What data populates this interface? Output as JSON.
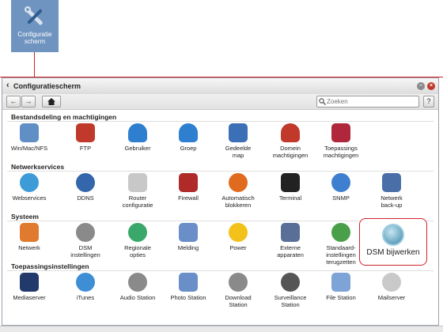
{
  "desktop_icon": {
    "label_line1": "Configuratie",
    "label_line2": "scherm"
  },
  "window": {
    "title": "Configuratiescherm"
  },
  "toolbar": {
    "search_placeholder": "Zoeken",
    "help_label": "?"
  },
  "sections": [
    {
      "title": "Bestandsdeling en machtigingen",
      "items": [
        {
          "l1": "Win/Mac/NFS",
          "l2": "",
          "color": "#5f8fc4"
        },
        {
          "l1": "FTP",
          "l2": "",
          "color": "#c0392b"
        },
        {
          "l1": "Gebruiker",
          "l2": "",
          "color": "#2f7fd1"
        },
        {
          "l1": "Groep",
          "l2": "",
          "color": "#2f7fd1"
        },
        {
          "l1": "Gedeelde",
          "l2": "map",
          "color": "#3b6fb6"
        },
        {
          "l1": "Domein",
          "l2": "machtigingen",
          "color": "#c0392b"
        },
        {
          "l1": "Toepassings",
          "l2": "machtigingen",
          "color": "#b0263b"
        }
      ]
    },
    {
      "title": "Netwerkservices",
      "items": [
        {
          "l1": "Webservices",
          "l2": "",
          "color": "#3d9bd8"
        },
        {
          "l1": "DDNS",
          "l2": "",
          "color": "#3366aa"
        },
        {
          "l1": "Router",
          "l2": "configuratie",
          "color": "#c8c8c8"
        },
        {
          "l1": "Firewall",
          "l2": "",
          "color": "#b02a2a"
        },
        {
          "l1": "Automatisch",
          "l2": "blokkeren",
          "color": "#e06a1e"
        },
        {
          "l1": "Terminal",
          "l2": "",
          "color": "#222222"
        },
        {
          "l1": "SNMP",
          "l2": "",
          "color": "#3f7fd0"
        },
        {
          "l1": "Netwerk",
          "l2": "back-up",
          "color": "#4a6fa8"
        }
      ]
    },
    {
      "title": "Systeem",
      "items": [
        {
          "l1": "Netwerk",
          "l2": "",
          "color": "#e07a2e"
        },
        {
          "l1": "DSM",
          "l2": "instellingen",
          "color": "#8a8a8a"
        },
        {
          "l1": "Regionale",
          "l2": "opties",
          "color": "#3aa86b"
        },
        {
          "l1": "Melding",
          "l2": "",
          "color": "#6a8fc8"
        },
        {
          "l1": "Power",
          "l2": "",
          "color": "#f2c21a"
        },
        {
          "l1": "Externe",
          "l2": "apparaten",
          "color": "#5a6f98"
        },
        {
          "l1": "Standaard-",
          "l2": "instellingen",
          "l3": "terugzetten",
          "color": "#4aa04a"
        }
      ]
    },
    {
      "title": "Toepassingsinstellingen",
      "items": [
        {
          "l1": "Mediaserver",
          "l2": "",
          "color": "#223a6b"
        },
        {
          "l1": "iTunes",
          "l2": "",
          "color": "#3e8ed6"
        },
        {
          "l1": "Audio Station",
          "l2": "",
          "color": "#8a8a8a"
        },
        {
          "l1": "Photo Station",
          "l2": "",
          "color": "#6a8fc8"
        },
        {
          "l1": "Download",
          "l2": "Station",
          "color": "#8a8a8a"
        },
        {
          "l1": "Surveillance",
          "l2": "Station",
          "color": "#555555"
        },
        {
          "l1": "File Station",
          "l2": "",
          "color": "#7ea3d6"
        },
        {
          "l1": "Mailserver",
          "l2": "",
          "color": "#c9c9c9"
        }
      ]
    }
  ],
  "highlighted_item": {
    "label": "DSM bijwerken",
    "color": "#3b87a8"
  }
}
